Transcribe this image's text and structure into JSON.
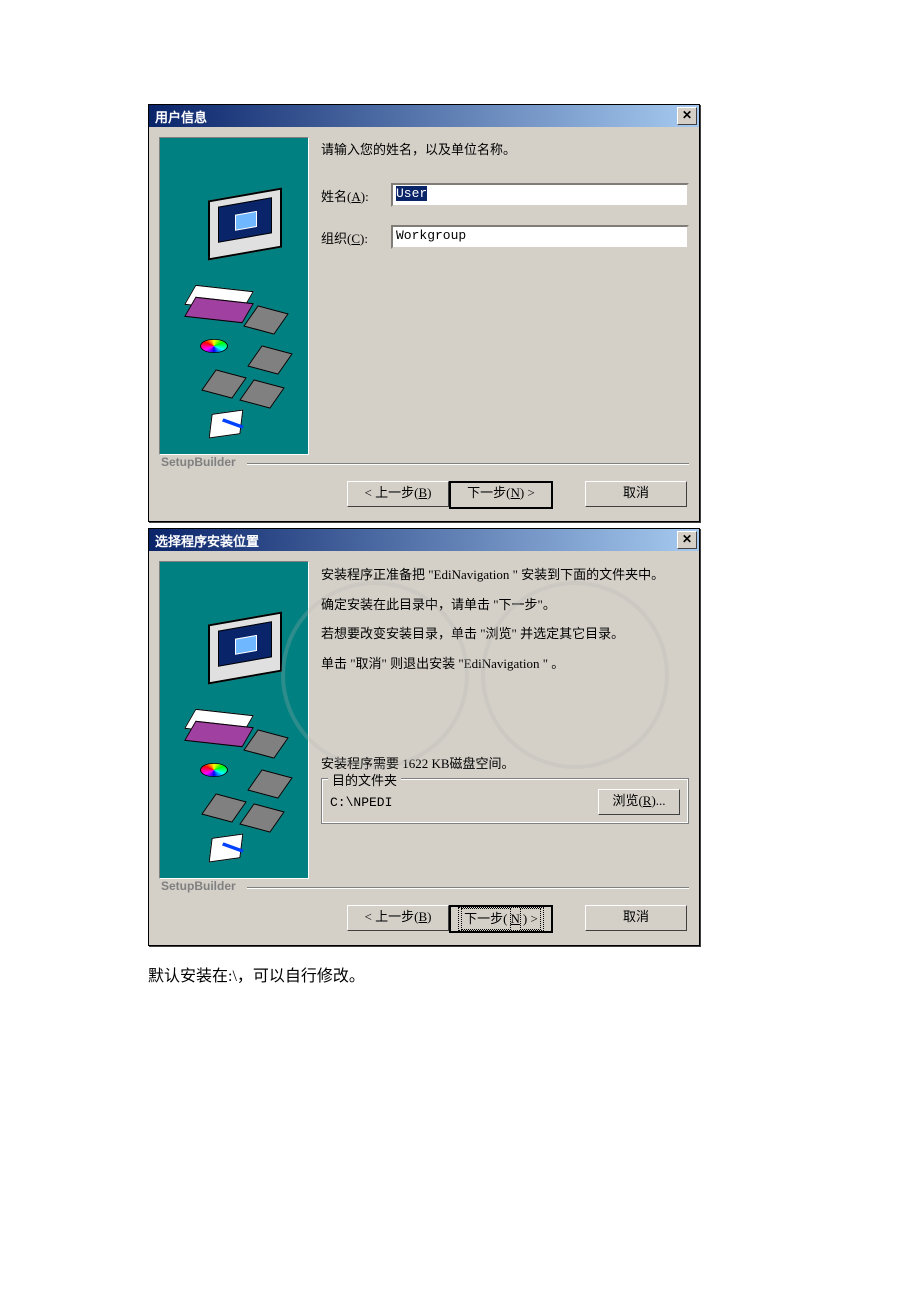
{
  "dialog1": {
    "title": "用户信息",
    "instruction": "请输入您的姓名，以及单位名称。",
    "name_label_pre": "姓名(",
    "name_label_u": "A",
    "name_label_post": "):",
    "name_value": "User",
    "org_label_pre": "组织(",
    "org_label_u": "C",
    "org_label_post": "):",
    "org_value": "Workgroup",
    "brand": "SetupBuilder",
    "back_pre": "< 上一步(",
    "back_u": "B",
    "back_post": ")",
    "next_pre": "下一步(",
    "next_u": "N",
    "next_post": ") >",
    "cancel": "取消"
  },
  "dialog2": {
    "title": "选择程序安装位置",
    "p1": "安装程序正准备把 \"EdiNavigation \" 安装到下面的文件夹中。",
    "p2": "确定安装在此目录中，请单击 \"下一步\"。",
    "p3": "若想要改变安装目录，单击 \"浏览\" 并选定其它目录。",
    "p4": "单击 \"取消\" 则退出安装 \"EdiNavigation \" 。",
    "disk_space": "安装程序需要 1622 KB磁盘空间。",
    "group_legend": "目的文件夹",
    "install_path": "C:\\NPEDI",
    "browse_pre": "浏览(",
    "browse_u": "R",
    "browse_post": ")...",
    "brand": "SetupBuilder",
    "back_pre": "< 上一步(",
    "back_u": "B",
    "back_post": ")",
    "next_pre": "下一步(",
    "next_u": "N",
    "next_post": ") >",
    "cancel": "取消"
  },
  "caption": "默认安装在:\\，可以自行修改。"
}
